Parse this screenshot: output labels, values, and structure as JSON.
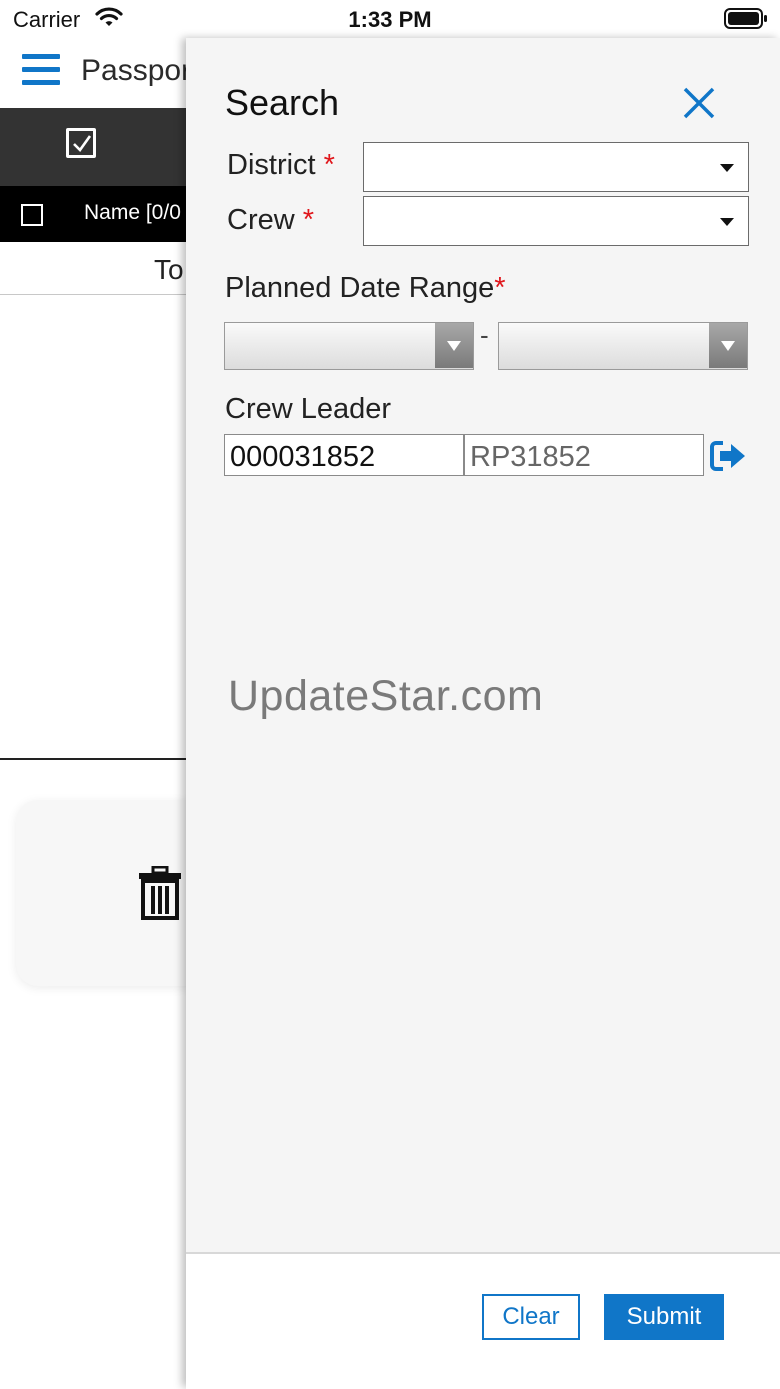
{
  "status_bar": {
    "carrier": "Carrier",
    "time": "1:33 PM"
  },
  "background_app": {
    "title": "Passpor",
    "header_column": "Name [0/0",
    "subheader": "To"
  },
  "search_panel": {
    "title": "Search",
    "district_label": "District",
    "district_value": "",
    "crew_label": "Crew",
    "crew_value": "",
    "required_mark": "*",
    "date_range_label": "Planned Date Range",
    "date_separator": "-",
    "crew_leader_label": "Crew Leader",
    "crew_leader_id": "000031852",
    "crew_leader_code": "RP31852",
    "watermark": "UpdateStar.com",
    "clear_label": "Clear",
    "submit_label": "Submit"
  },
  "colors": {
    "accent": "#1076c8",
    "required": "#e0161b",
    "toolbar": "#333333"
  },
  "icons": [
    "wifi-icon",
    "battery-icon",
    "hamburger-icon",
    "checkbox-icon",
    "trash-icon",
    "close-icon",
    "goto-icon"
  ]
}
